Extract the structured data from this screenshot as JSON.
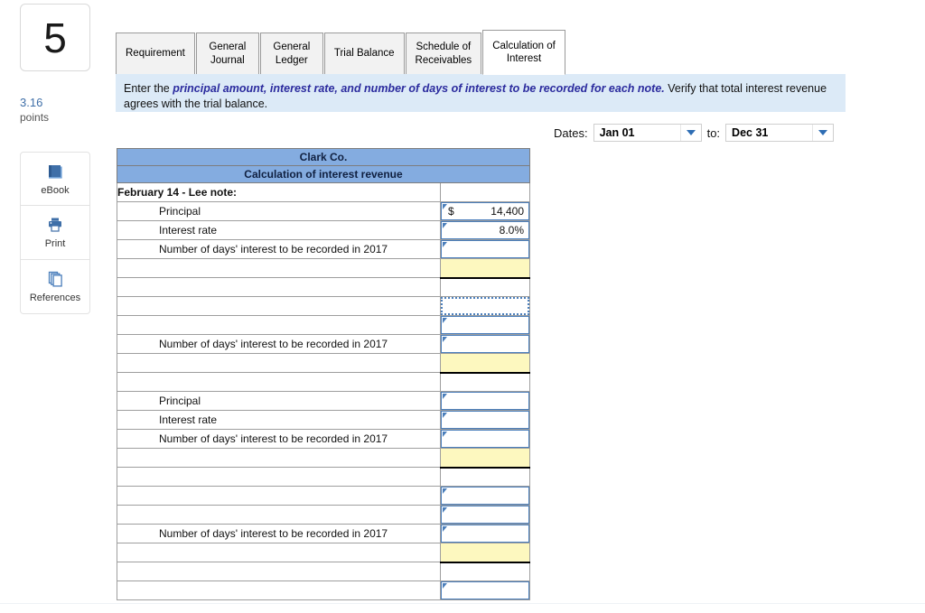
{
  "question": {
    "number": "5",
    "points_value": "3.16",
    "points_label": "points"
  },
  "tools": [
    {
      "label": "eBook",
      "icon": "book-icon"
    },
    {
      "label": "Print",
      "icon": "printer-icon"
    },
    {
      "label": "References",
      "icon": "copy-pages-icon"
    }
  ],
  "tabs": [
    {
      "label": "Requirement",
      "active": false
    },
    {
      "label": "General\nJournal",
      "active": false
    },
    {
      "label": "General\nLedger",
      "active": false
    },
    {
      "label": "Trial Balance",
      "active": false
    },
    {
      "label": "Schedule of\nReceivables",
      "active": false
    },
    {
      "label": "Calculation of\nInterest",
      "active": true
    }
  ],
  "banner": {
    "lead": "Enter the ",
    "emphasis": "principal amount, interest rate, and number of days of interest to be recorded for each note.",
    "tail": "  Verify that total interest revenue agrees with the trial balance."
  },
  "dates": {
    "label": "Dates:",
    "from_value": "Jan 01",
    "separator_label": "to:",
    "to_value": "Dec 31"
  },
  "sheet": {
    "title": "Clark Co.",
    "subtitle": "Calculation of interest revenue",
    "rows": [
      {
        "label": "February 14 - Lee note:",
        "style": "bold",
        "cell": "plain"
      },
      {
        "label": "Principal",
        "style": "indent",
        "cell": "input",
        "currency": "$",
        "value": "14,400"
      },
      {
        "label": "Interest rate",
        "style": "indent",
        "cell": "input",
        "currency": "",
        "value": "8.0%"
      },
      {
        "label": "Number of days' interest to be recorded in 2017",
        "style": "indent",
        "cell": "input",
        "currency": "",
        "value": ""
      },
      {
        "label": "",
        "style": "indent",
        "cell": "yellow"
      },
      {
        "label": "",
        "style": "indent",
        "cell": "plain"
      },
      {
        "label": "",
        "style": "indent",
        "cell": "dotted"
      },
      {
        "label": "",
        "style": "indent",
        "cell": "input",
        "currency": "",
        "value": ""
      },
      {
        "label": "Number of days' interest to be recorded in 2017",
        "style": "indent",
        "cell": "input",
        "currency": "",
        "value": ""
      },
      {
        "label": "",
        "style": "indent",
        "cell": "yellow"
      },
      {
        "label": "",
        "style": "indent",
        "cell": "plain"
      },
      {
        "label": "Principal",
        "style": "indent",
        "cell": "input",
        "currency": "",
        "value": ""
      },
      {
        "label": "Interest rate",
        "style": "indent",
        "cell": "input",
        "currency": "",
        "value": ""
      },
      {
        "label": "Number of days' interest to be recorded in 2017",
        "style": "indent",
        "cell": "input",
        "currency": "",
        "value": ""
      },
      {
        "label": "",
        "style": "indent",
        "cell": "yellow"
      },
      {
        "label": "",
        "style": "indent",
        "cell": "plain"
      },
      {
        "label": "",
        "style": "indent",
        "cell": "input",
        "currency": "",
        "value": ""
      },
      {
        "label": "",
        "style": "indent",
        "cell": "input",
        "currency": "",
        "value": ""
      },
      {
        "label": "Number of days' interest to be recorded in 2017",
        "style": "indent",
        "cell": "input",
        "currency": "",
        "value": ""
      },
      {
        "label": "",
        "style": "indent",
        "cell": "yellow"
      },
      {
        "label": "",
        "style": "indent",
        "cell": "plain"
      },
      {
        "label": "",
        "style": "indent",
        "cell": "input",
        "currency": "",
        "value": ""
      }
    ]
  },
  "colors": {
    "header_blue": "#84ace0",
    "banner_blue": "#dceaf7",
    "input_border": "#4a7ebb",
    "total_yellow": "#fdf8bf",
    "points_text": "#3f6fa8",
    "emphasis_text": "#2b2b9e"
  }
}
